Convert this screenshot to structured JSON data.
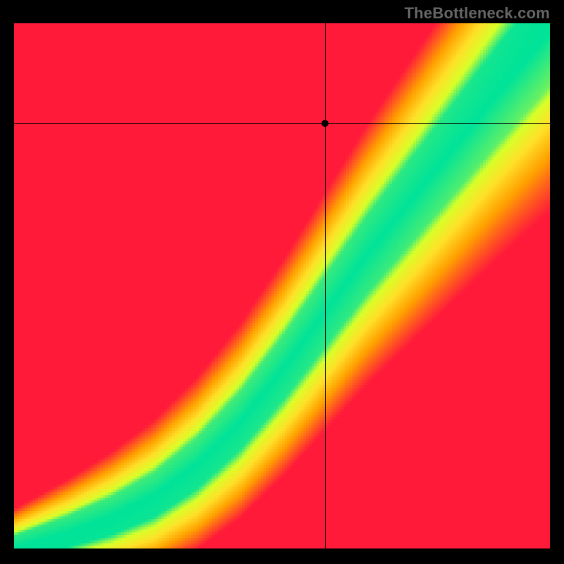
{
  "attribution": "TheBottleneck.com",
  "chart_data": {
    "type": "heatmap",
    "title": "",
    "xlabel": "",
    "ylabel": "",
    "x_range": [
      0,
      100
    ],
    "y_range": [
      0,
      100
    ],
    "marker": {
      "x": 58,
      "y": 81
    },
    "colorscale": [
      {
        "t": 0.0,
        "color": "#ff1a3a"
      },
      {
        "t": 0.33,
        "color": "#ffa000"
      },
      {
        "t": 0.58,
        "color": "#ffe028"
      },
      {
        "t": 0.8,
        "color": "#d8ff28"
      },
      {
        "t": 1.0,
        "color": "#00e399"
      }
    ],
    "optimal_curve": [
      {
        "x": 0,
        "y": 0
      },
      {
        "x": 10,
        "y": 3
      },
      {
        "x": 18,
        "y": 6
      },
      {
        "x": 26,
        "y": 10
      },
      {
        "x": 34,
        "y": 16
      },
      {
        "x": 42,
        "y": 24
      },
      {
        "x": 50,
        "y": 34
      },
      {
        "x": 58,
        "y": 45
      },
      {
        "x": 66,
        "y": 56
      },
      {
        "x": 74,
        "y": 66
      },
      {
        "x": 82,
        "y": 76
      },
      {
        "x": 90,
        "y": 86
      },
      {
        "x": 100,
        "y": 98
      }
    ],
    "band_width_start": 2.2,
    "band_width_end": 10.0,
    "transition_band_factor": 2.4,
    "corner_pull": {
      "top_left": {
        "color": "#ff1a3a",
        "strength": 1.0
      },
      "bottom_right": {
        "color": "#ff4a28",
        "strength": 0.6
      }
    }
  }
}
